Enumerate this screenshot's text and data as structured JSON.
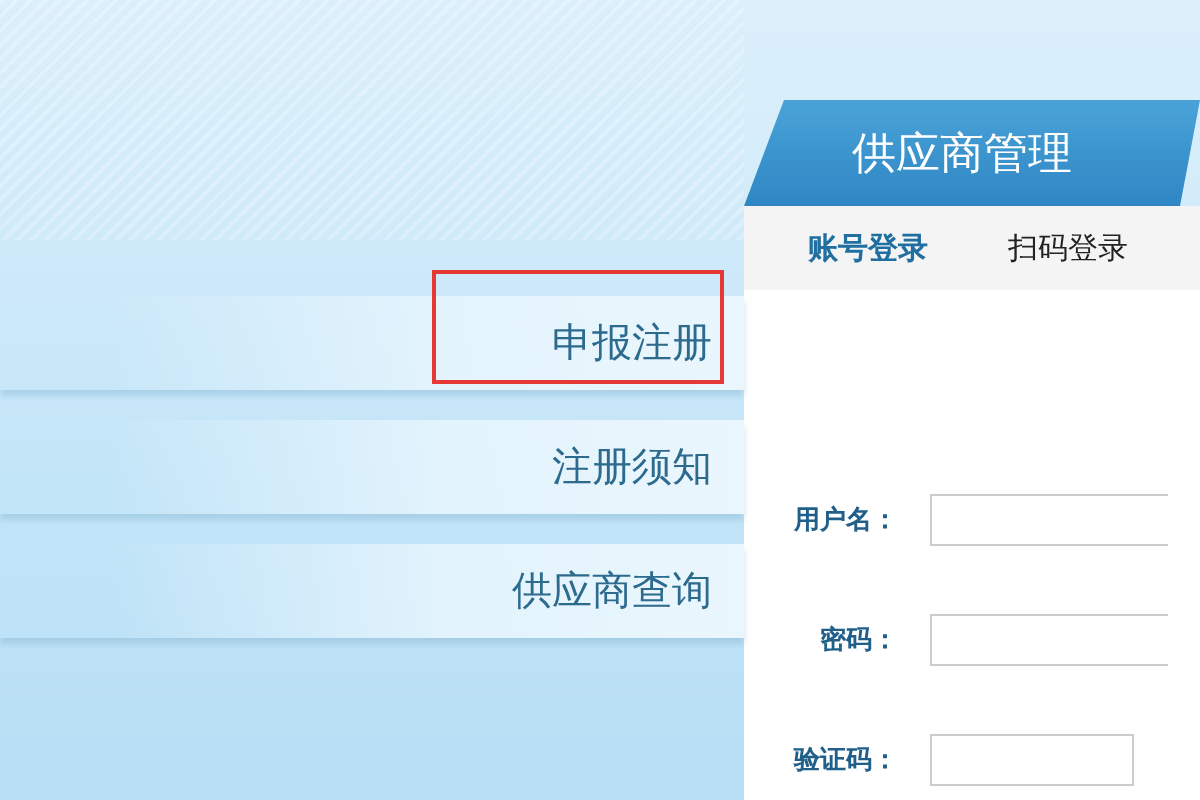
{
  "menu": [
    {
      "label": "申报注册",
      "highlighted": true
    },
    {
      "label": "注册须知",
      "highlighted": false
    },
    {
      "label": "供应商查询",
      "highlighted": false
    }
  ],
  "panel": {
    "title": "供应商管理",
    "tabs": [
      {
        "label": "账号登录",
        "selected": true
      },
      {
        "label": "扫码登录",
        "selected": false
      }
    ],
    "fields": [
      {
        "label": "用户名：",
        "kind": "wide"
      },
      {
        "label": "密码：",
        "kind": "wide"
      },
      {
        "label": "验证码：",
        "kind": "short"
      }
    ]
  }
}
